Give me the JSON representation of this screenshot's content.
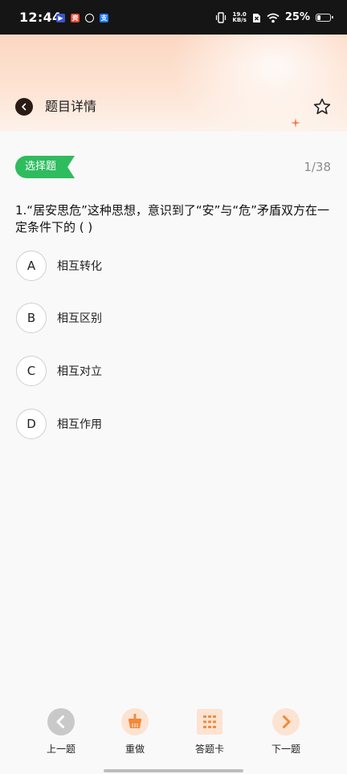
{
  "status_bar": {
    "time": "12:44",
    "net_speed_value": "19.0",
    "net_speed_unit": "KB/s",
    "battery_percent": "25%",
    "battery_level": 0.25
  },
  "header": {
    "title": "题目详情"
  },
  "question": {
    "type_tag": "选择题",
    "progress": "1/38",
    "text": "1.“居安思危”这种思想，意识到了“安”与“危”矛盾双方在一定条件下的 (    )",
    "options": [
      {
        "letter": "A",
        "text": "相互转化"
      },
      {
        "letter": "B",
        "text": "相互区别"
      },
      {
        "letter": "C",
        "text": "相互对立"
      },
      {
        "letter": "D",
        "text": "相互作用"
      }
    ]
  },
  "bottom_nav": {
    "prev": "上一题",
    "redo": "重做",
    "answer_card": "答题卡",
    "next": "下一题"
  },
  "colors": {
    "accent_green": "#2ebc5e",
    "accent_orange": "#f08a3c",
    "header_peach": "#fcd7c2"
  }
}
